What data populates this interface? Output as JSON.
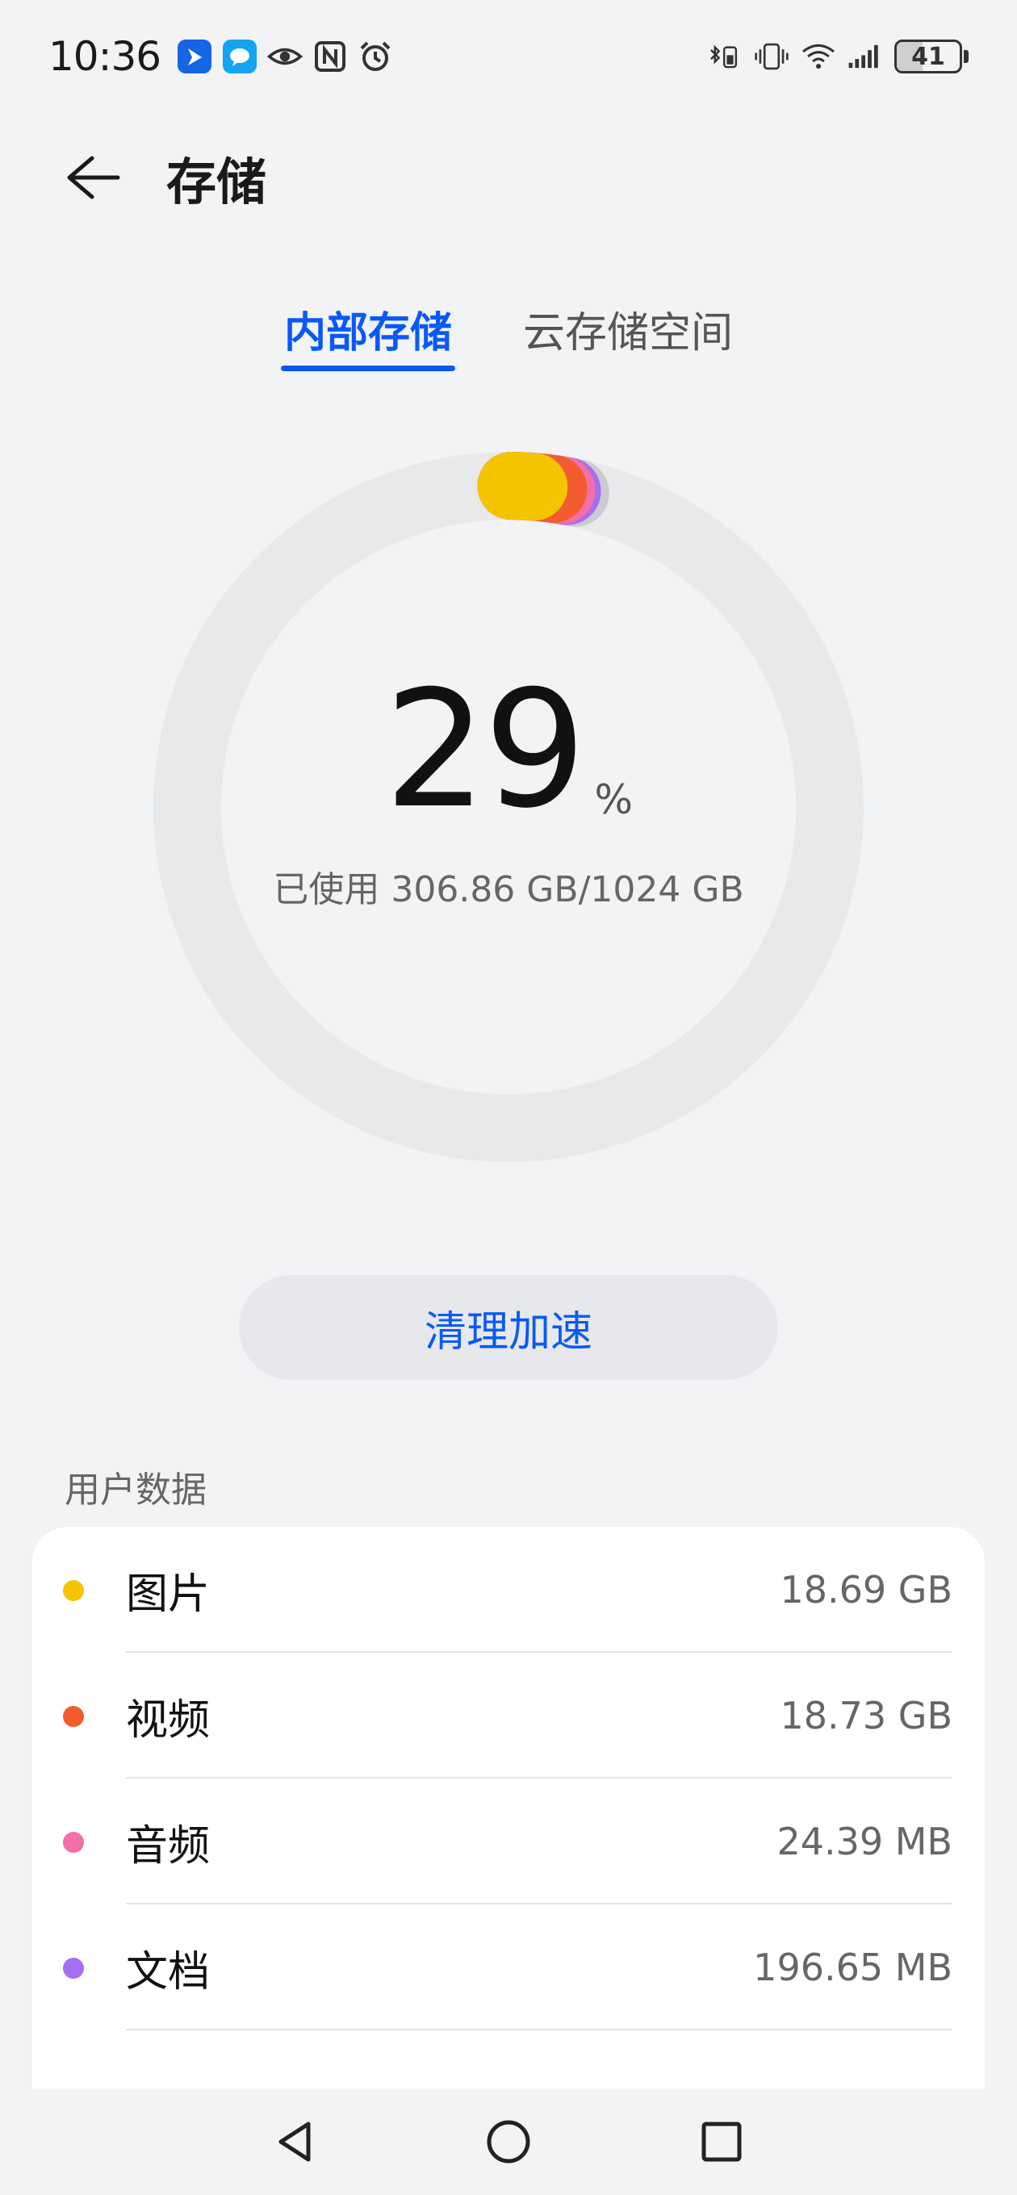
{
  "status_bar": {
    "time": "10:36",
    "battery_level": "41",
    "battery_fraction": 0.41,
    "left_icons": [
      "bird-app-icon",
      "message-app-icon",
      "eye-icon",
      "nfc-icon",
      "alarm-icon"
    ],
    "right_icons": [
      "bluetooth-battery-icon",
      "vibrate-icon",
      "wifi-icon",
      "signal-icon"
    ]
  },
  "header": {
    "title": "存储"
  },
  "tabs": [
    {
      "label": "内部存储",
      "active": true
    },
    {
      "label": "云存储空间",
      "active": false
    }
  ],
  "usage": {
    "percent": "29",
    "percent_unit": "%",
    "used_text": "已使用 306.86 GB/1024 GB",
    "used_fraction": 0.29
  },
  "actions": {
    "clean_label": "清理加速"
  },
  "user_data": {
    "section_title": "用户数据",
    "items": [
      {
        "label": "图片",
        "value": "18.69 GB",
        "color": "#f5c400"
      },
      {
        "label": "视频",
        "value": "18.73 GB",
        "color": "#f25c2f"
      },
      {
        "label": "音频",
        "value": "24.39 MB",
        "color": "#f36fa6"
      },
      {
        "label": "文档",
        "value": "196.65 MB",
        "color": "#a66ef0"
      }
    ]
  },
  "colors": {
    "accent": "#0a59f7",
    "ring_track": "#e8e9eb",
    "ring_gray_segment": "#c8c8cc"
  },
  "nav": {
    "icons": [
      "back-triangle-icon",
      "home-circle-icon",
      "recents-square-icon"
    ]
  }
}
